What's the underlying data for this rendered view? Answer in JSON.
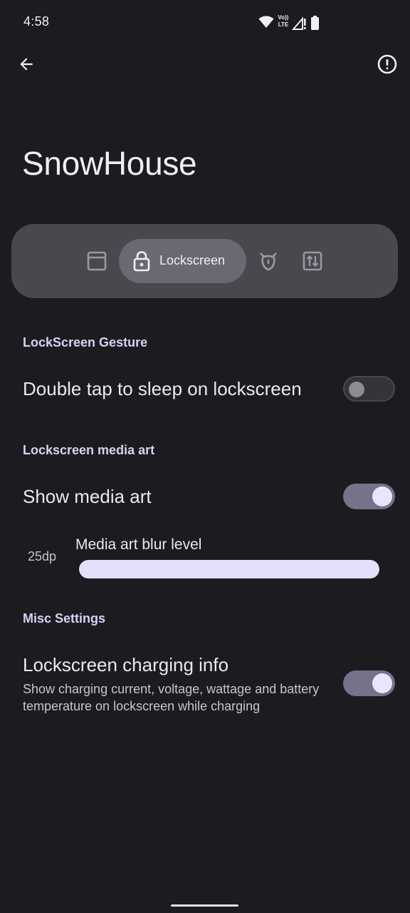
{
  "status_bar": {
    "time": "4:58",
    "icons": [
      "wifi-icon",
      "volte-icon",
      "cell-signal-icon",
      "battery-icon"
    ]
  },
  "top_bar": {
    "back_icon": "arrow-back-icon",
    "info_icon": "info-icon"
  },
  "page": {
    "title": "SnowHouse"
  },
  "tabs": [
    {
      "icon": "window-icon",
      "label": "",
      "selected": false
    },
    {
      "icon": "lock-icon",
      "label": "Lockscreen",
      "selected": true
    },
    {
      "icon": "ghost-icon",
      "label": "",
      "selected": false
    },
    {
      "icon": "swap-vert-icon",
      "label": "",
      "selected": false
    }
  ],
  "sections": {
    "gesture": {
      "header": "LockScreen Gesture",
      "double_tap": {
        "title": "Double tap to sleep on lockscreen",
        "enabled": false
      }
    },
    "media_art": {
      "header": "Lockscreen media art",
      "show": {
        "title": "Show media art",
        "enabled": true
      },
      "blur": {
        "title": "Media art blur level",
        "value_label": "25dp",
        "value": 25,
        "max": 25
      }
    },
    "misc": {
      "header": "Misc Settings",
      "charging": {
        "title": "Lockscreen charging info",
        "summary": "Show charging current, voltage, wattage and battery temperature on lockscreen while charging",
        "enabled": true
      }
    }
  },
  "colors": {
    "background": "#1c1b20",
    "accent": "#d6d2f5",
    "switch_on_track": "#777189",
    "switch_on_thumb": "#e8e6ff",
    "tab_bar": "#4a484e",
    "tab_active": "#6a6870"
  }
}
